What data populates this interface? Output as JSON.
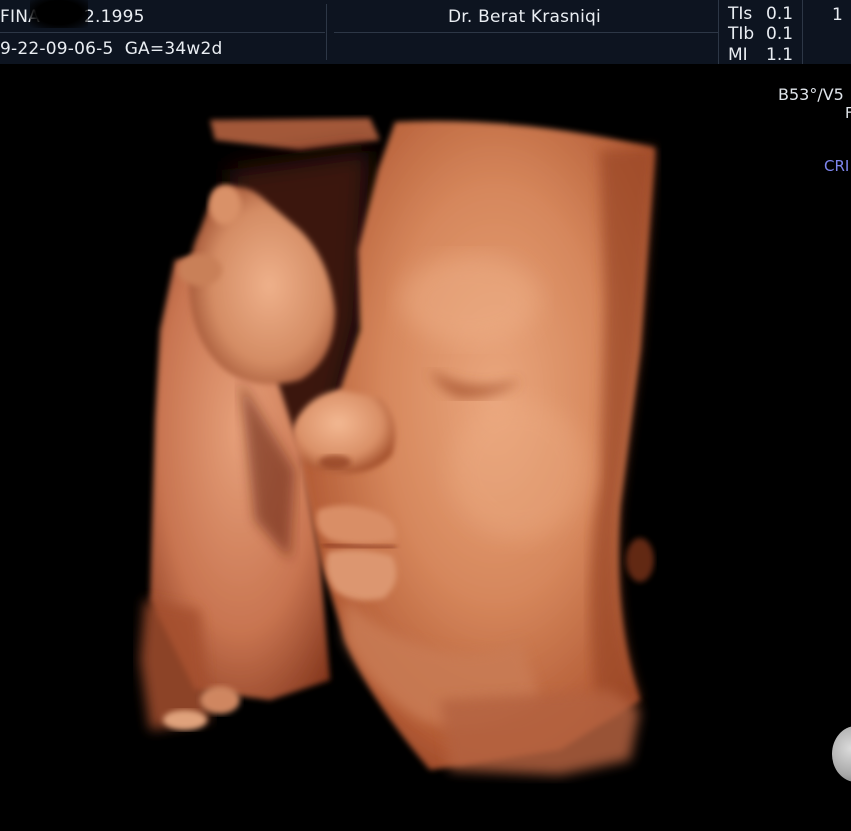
{
  "header": {
    "patient_name": "FINA",
    "birth_date": "2.1995",
    "exam_id": "9-22-09-06-5",
    "gestational_age": "GA=34w2d",
    "doctor": "Dr. Berat Krasniqi",
    "corner_number": "1"
  },
  "indices": [
    {
      "label": "TIs",
      "value": "0.1"
    },
    {
      "label": "TIb",
      "value": "0.1"
    },
    {
      "label": "MI",
      "value": "1.1"
    }
  ],
  "side_panel": {
    "probe_setting": "B53°/V5",
    "probe_sub": "F",
    "mode_label": "CRI"
  },
  "colors": {
    "background": "#000000",
    "header_bg": "#0d1420",
    "header_text": "#e9edf2",
    "mode_label": "#7e86ee",
    "skin_light": "#e8a47c",
    "skin_mid": "#c8704a",
    "skin_dark": "#6e2a16"
  },
  "image": {
    "type": "3D ultrasound surface render"
  }
}
